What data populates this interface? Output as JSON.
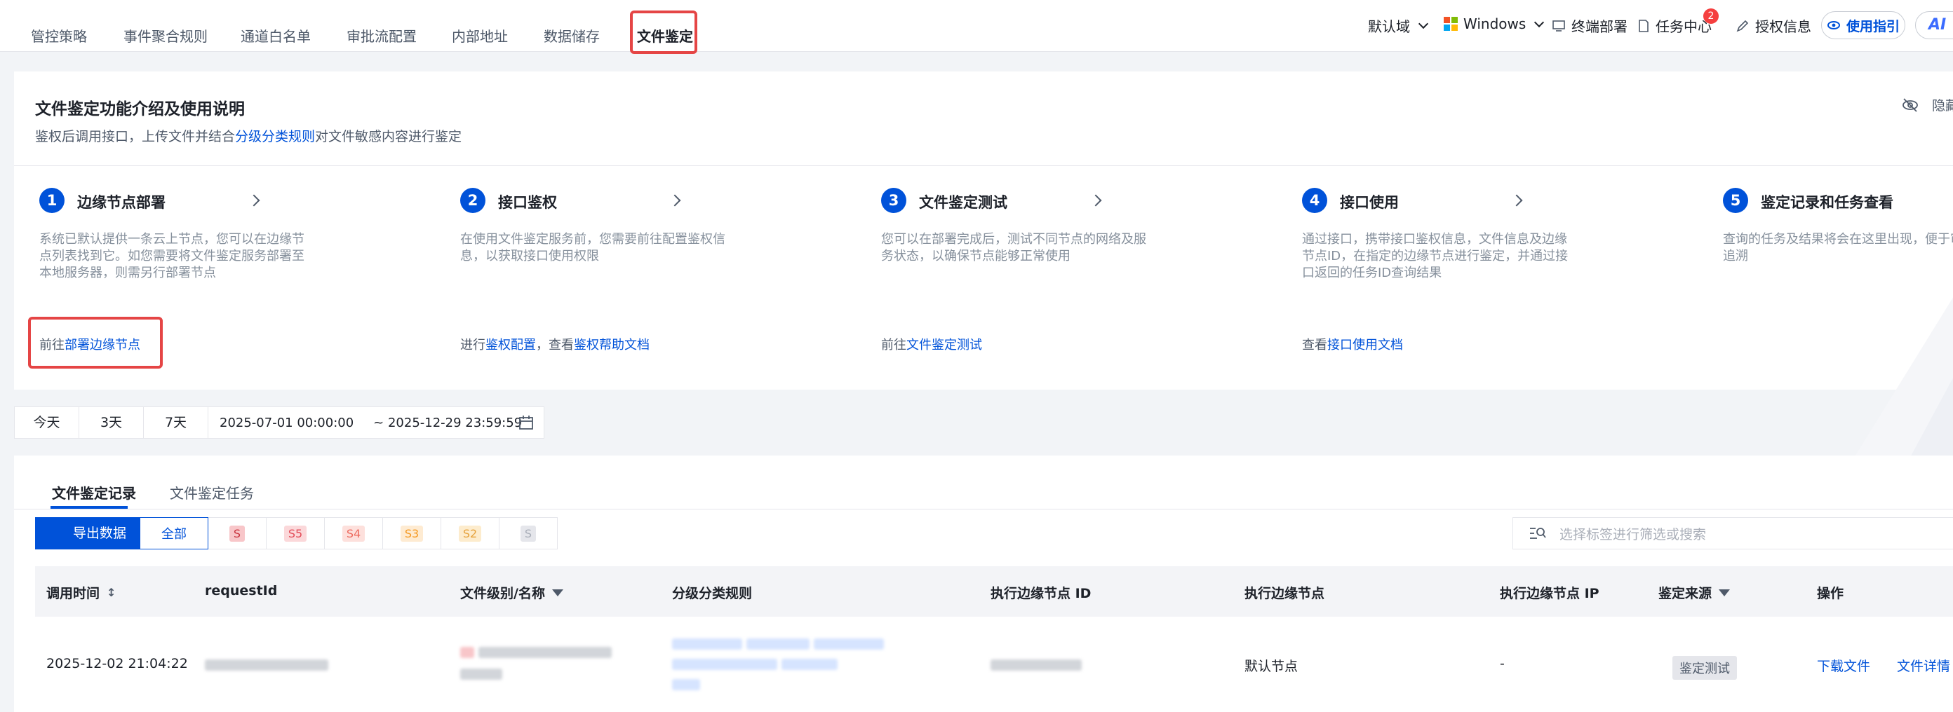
{
  "top_tabs": [
    "管控策略",
    "事件聚合规则",
    "通道白名单",
    "审批流配置",
    "内部地址",
    "数据储存",
    "文件鉴定"
  ],
  "active_tab": "文件鉴定",
  "topbar_right": {
    "domain": "默认域",
    "os": "Windows",
    "deploy": "终端部署",
    "tasks": "任务中心",
    "task_badge": "2",
    "license": "授权信息",
    "guide": "使用指引",
    "ai": "AI"
  },
  "intro": {
    "title": "文件鉴定功能介绍及使用说明",
    "subtitle_prefix": "鉴权后调用接口，上传文件并结合",
    "subtitle_link": "分级分类规则",
    "subtitle_suffix": "对文件敏感内容进行鉴定",
    "hide_label": "隐藏",
    "steps": [
      {
        "num": "1",
        "title": "边缘节点部署",
        "desc": "系统已默认提供一条云上节点，您可以在边缘节点列表找到它。如您需要将文件鉴定服务部署至本地服务器，则需另行部署节点",
        "link_prefix": "前往",
        "link": "部署边缘节点",
        "link_mid": "",
        "link2": ""
      },
      {
        "num": "2",
        "title": "接口鉴权",
        "desc": "在使用文件鉴定服务前，您需要前往配置鉴权信息，以获取接口使用权限",
        "link_prefix": "进行",
        "link": "鉴权配置",
        "link_mid": "，查看",
        "link2": "鉴权帮助文档"
      },
      {
        "num": "3",
        "title": "文件鉴定测试",
        "desc": "您可以在部署完成后，测试不同节点的网络及服务状态，以确保节点能够正常使用",
        "link_prefix": "前往",
        "link": "文件鉴定测试",
        "link_mid": "",
        "link2": ""
      },
      {
        "num": "4",
        "title": "接口使用",
        "desc": "通过接口，携带接口鉴权信息，文件信息及边缘节点ID，在指定的边缘节点进行鉴定，并通过接口返回的任务ID查询结果",
        "link_prefix": "查看",
        "link": "接口使用文档",
        "link_mid": "",
        "link2": ""
      },
      {
        "num": "5",
        "title": "鉴定记录和任务查看",
        "desc": "查询的任务及结果将会在这里出现，便于审计和追溯",
        "link_prefix": "",
        "link": "",
        "link_mid": "",
        "link2": ""
      }
    ]
  },
  "date_filter": {
    "buttons": [
      "今天",
      "3天",
      "7天"
    ],
    "start": "2025-07-01 00:00:00",
    "end": "~ 2025-12-29 23:59:59"
  },
  "records": {
    "tabs": [
      "文件鉴定记录",
      "文件鉴定任务"
    ],
    "export": "导出数据",
    "levels": [
      {
        "label": "全部",
        "color": "#0052d9",
        "bg": "transparent"
      },
      {
        "label": "S",
        "color": "#c9353f",
        "bg": "#f8c6c9"
      },
      {
        "label": "S5",
        "color": "#e34d59",
        "bg": "#fbd8da"
      },
      {
        "label": "S4",
        "color": "#ed6a5e",
        "bg": "#fde0dc"
      },
      {
        "label": "S3",
        "color": "#f59a23",
        "bg": "#feebd2"
      },
      {
        "label": "S2",
        "color": "#e6a23c",
        "bg": "#fdeccd"
      },
      {
        "label": "S",
        "color": "#a9aeb8",
        "bg": "#e5e6eb"
      }
    ],
    "search_placeholder": "选择标签进行筛选或搜索",
    "columns": [
      "调用时间",
      "requestId",
      "文件级别/名称",
      "分级分类规则",
      "执行边缘节点 ID",
      "执行边缘节点",
      "执行边缘节点 IP",
      "鉴定来源",
      "操作"
    ],
    "rows": [
      {
        "time": "2025-12-02 21:04:22",
        "node": "默认节点",
        "ip": "-",
        "source": "鉴定测试",
        "op1": "下载文件",
        "op2": "文件详情"
      }
    ]
  }
}
